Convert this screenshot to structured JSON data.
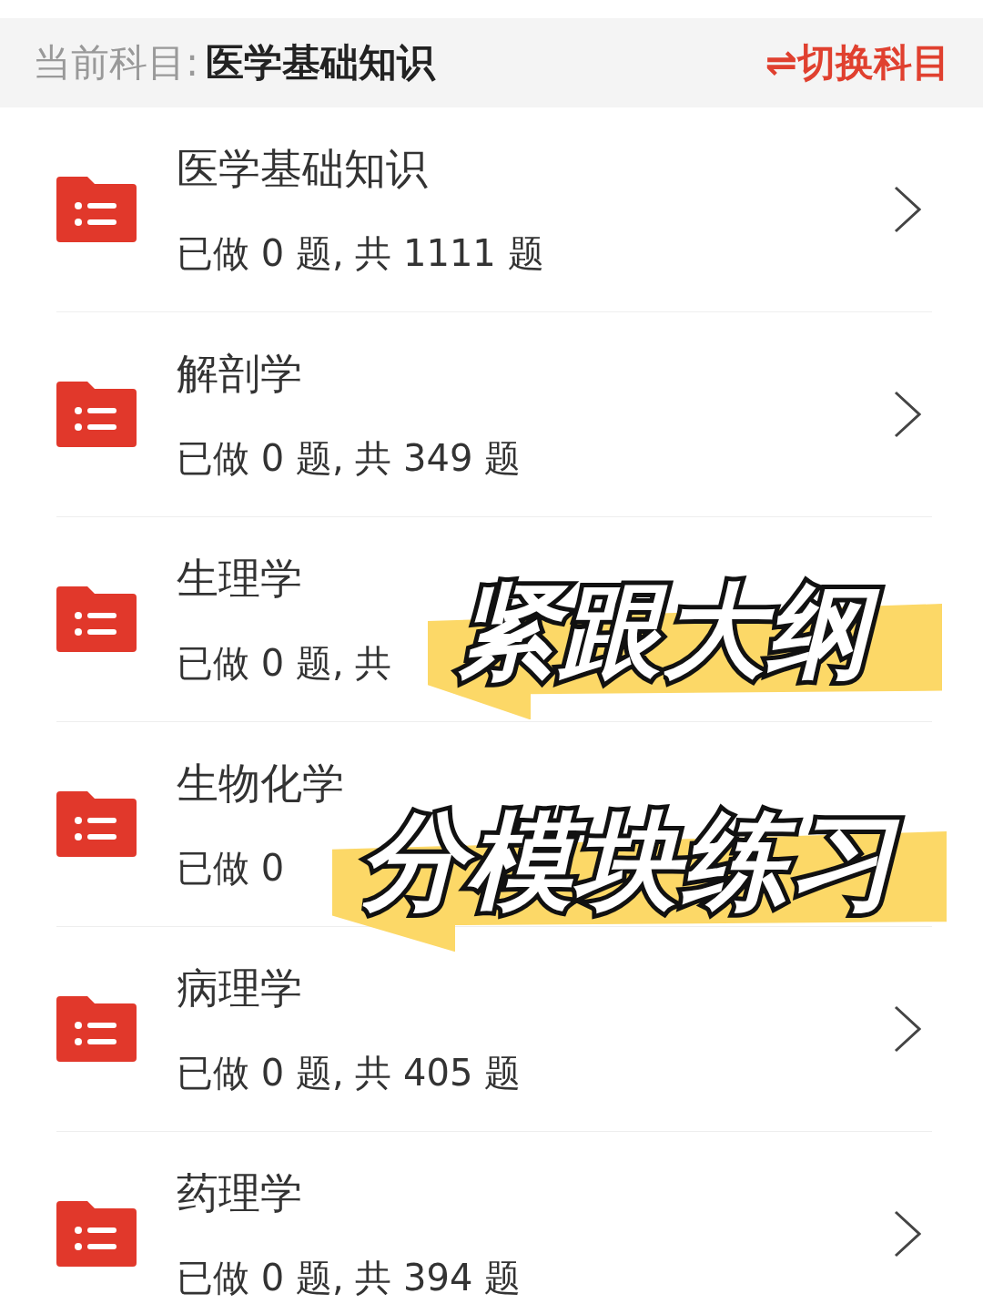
{
  "header": {
    "label": "当前科目:",
    "subject": "医学基础知识",
    "switch_icon": "⇌",
    "switch_label": "切换科目"
  },
  "subjects": [
    {
      "name": "医学基础知识",
      "progress": "已做 0 题, 共 1111 题",
      "arrow": true
    },
    {
      "name": "解剖学",
      "progress": "已做 0 题, 共 349 题",
      "arrow": true
    },
    {
      "name": "生理学",
      "progress": "已做 0 题, 共",
      "arrow": false
    },
    {
      "name": "生物化学",
      "progress": "已做 0",
      "arrow": false
    },
    {
      "name": "病理学",
      "progress": "已做 0 题, 共 405 题",
      "arrow": true
    },
    {
      "name": "药理学",
      "progress": "已做 0 题, 共 394 题",
      "arrow": true
    }
  ],
  "stickers": [
    "紧跟大纲",
    "分模块练习"
  ]
}
